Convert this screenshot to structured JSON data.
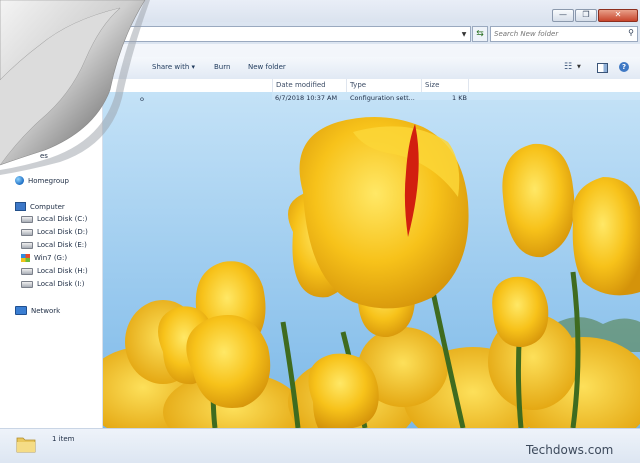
{
  "titlebar": {
    "minimize_glyph": "—",
    "maximize_glyph": "❐",
    "close_glyph": "✕"
  },
  "address": {
    "dropdown_glyph": "▼",
    "refresh_glyph": "⇆"
  },
  "search": {
    "placeholder": "Search New folder",
    "icon": "search-icon"
  },
  "toolbar": {
    "share_label": "Share with ▾",
    "burn_label": "Burn",
    "new_folder_label": "New folder",
    "view_glyph": "☷",
    "view_dd_glyph": "▼",
    "help_glyph": "?"
  },
  "columns": {
    "date_modified": "Date modified",
    "type": "Type",
    "size": "Size"
  },
  "files": [
    {
      "name_fragment": "o",
      "date": "6/7/2018 10:37 AM",
      "type": "Configuration sett...",
      "size": "1 KB"
    }
  ],
  "nav": {
    "partial_label": "es",
    "homegroup": "Homegroup",
    "computer": "Computer",
    "drives": [
      {
        "label": "Local Disk (C:)",
        "icon": "disk-icon"
      },
      {
        "label": "Local Disk (D:)",
        "icon": "disk-icon"
      },
      {
        "label": "Local Disk (E:)",
        "icon": "disk-icon"
      },
      {
        "label": "Win7 (G:)",
        "icon": "windows-logo-icon"
      },
      {
        "label": "Local Disk (H:)",
        "icon": "disk-icon"
      },
      {
        "label": "Local Disk (I:)",
        "icon": "disk-icon"
      }
    ],
    "network": "Network"
  },
  "status": {
    "item_count": "1 item"
  },
  "watermark": "Techdows.com",
  "colors": {
    "tulip_yellow": "#f5c518",
    "tulip_dark": "#d99a0a",
    "sky": "#8cc3ec",
    "stem": "#3f6b1f"
  }
}
